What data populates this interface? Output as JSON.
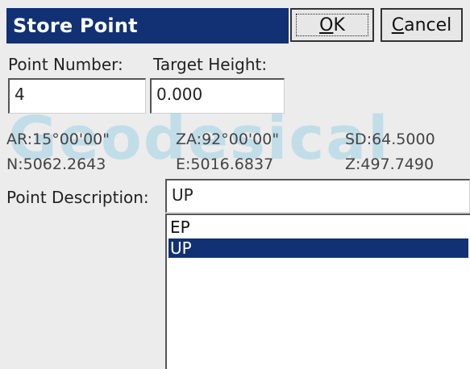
{
  "dialog": {
    "title": "Store Point",
    "ok_prefix": "",
    "ok_underlined": "O",
    "ok_rest": "K",
    "cancel_underlined": "C",
    "cancel_rest": "ancel"
  },
  "fields": {
    "point_number_label": "Point Number:",
    "point_number_value": "4",
    "target_height_label": "Target Height:",
    "target_height_value": "0.000"
  },
  "readouts": {
    "ar": "AR:15°00'00\"",
    "za": "ZA:92°00'00\"",
    "sd": "SD:64.5000",
    "n": "N:5062.2643",
    "e": "E:5016.6837",
    "z": "Z:497.7490"
  },
  "watermark": "Geodesical",
  "description": {
    "label": "Point Description:",
    "value": "UP",
    "options": [
      "EP",
      "UP"
    ],
    "selected": "UP"
  },
  "colors": {
    "title_bar": "#123174",
    "selection": "#123174",
    "background": "#ececec"
  }
}
